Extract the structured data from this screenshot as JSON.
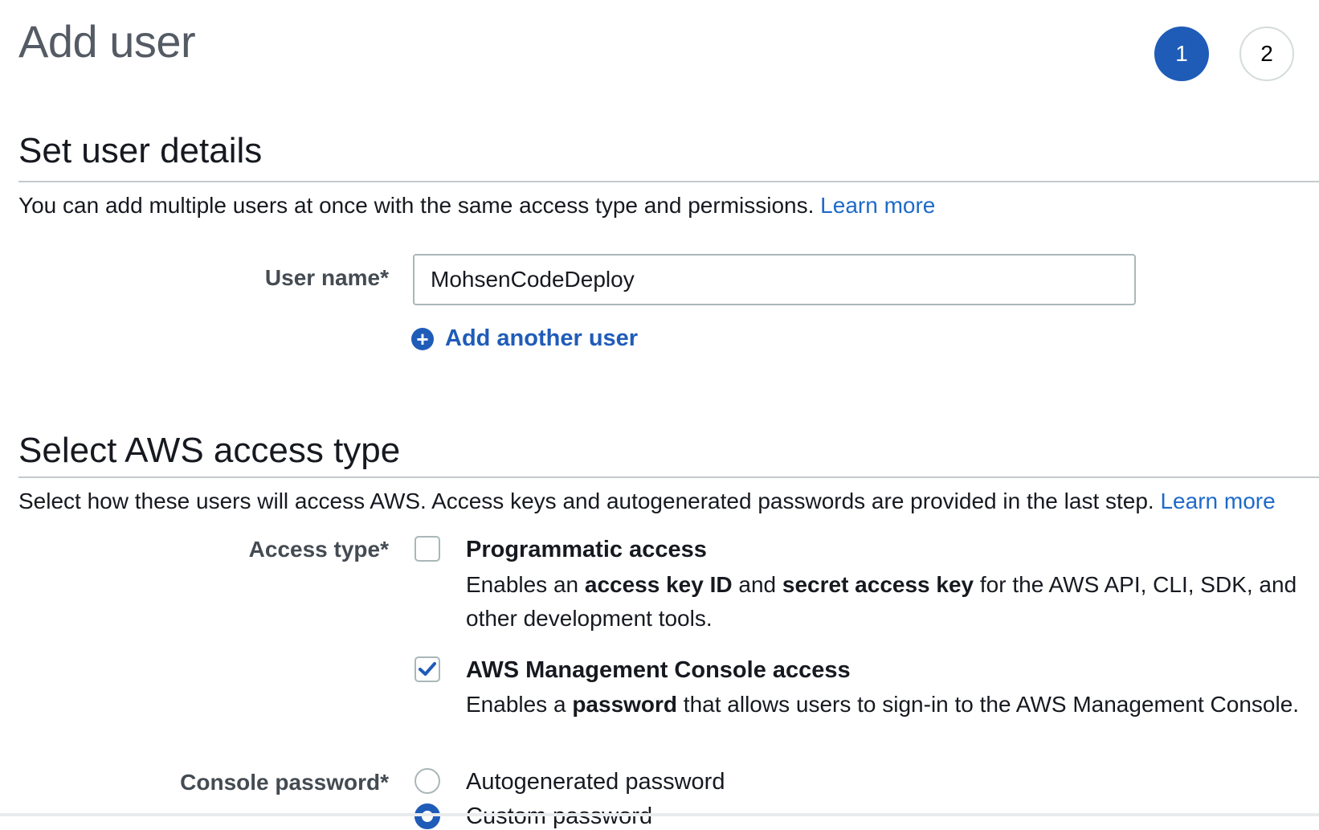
{
  "header": {
    "title": "Add user",
    "steps": [
      "1",
      "2"
    ]
  },
  "details": {
    "heading": "Set user details",
    "description": "You can add multiple users at once with the same access type and permissions.",
    "learn_more": "Learn more",
    "user_name_label": "User name*",
    "user_name_value": "MohsenCodeDeploy",
    "add_another_user": "Add another user"
  },
  "access": {
    "heading": "Select AWS access type",
    "description": "Select how these users will access AWS. Access keys and autogenerated passwords are provided in the last step.",
    "learn_more": "Learn more",
    "access_type_label": "Access type*",
    "options": [
      {
        "title": "Programmatic access",
        "checked": false,
        "desc_1": "Enables an ",
        "desc_b1": "access key ID",
        "desc_2": " and ",
        "desc_b2": "secret access key",
        "desc_3": " for the AWS API, CLI, SDK, and other development tools."
      },
      {
        "title": "AWS Management Console access",
        "checked": true,
        "desc_1": "Enables a ",
        "desc_b1": "password",
        "desc_2": " that allows users to sign-in to the AWS Management Console."
      }
    ],
    "console_password_label": "Console password*",
    "password_options": [
      {
        "label": "Autogenerated password",
        "selected": false
      },
      {
        "label": "Custom password",
        "selected": true
      }
    ]
  },
  "colors": {
    "accent": "#1f5cb8",
    "link": "#1e6ac9"
  }
}
